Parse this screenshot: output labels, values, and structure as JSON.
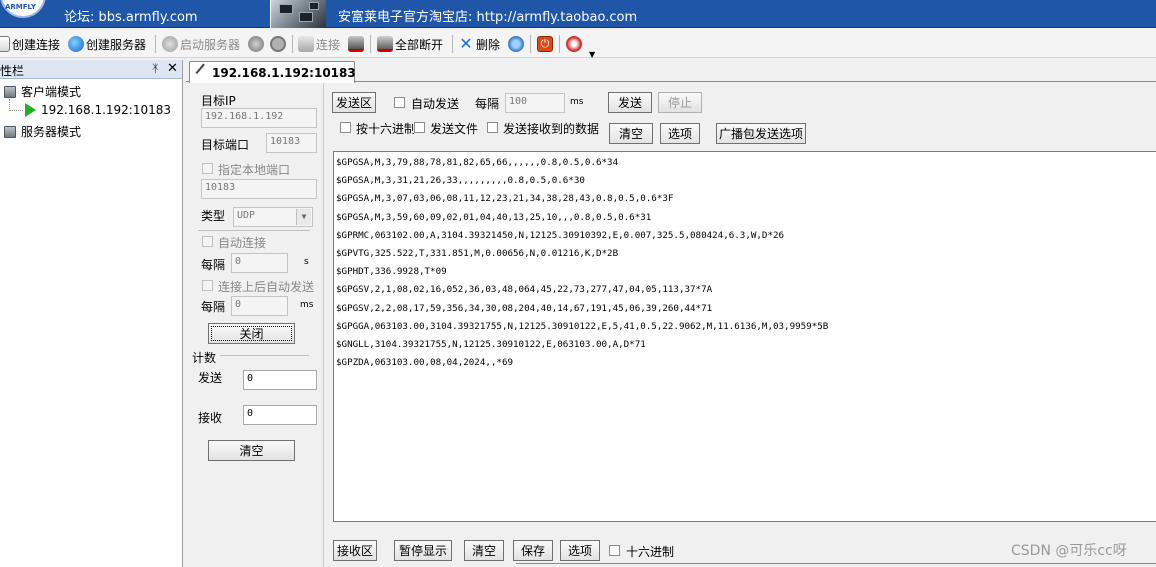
{
  "banner": {
    "logo_text": "ARMFLY",
    "forum_text": "论坛: bbs.armfly.com",
    "shop_text": "安富莱电子官方淘宝店: http://armfly.taobao.com"
  },
  "toolbar": {
    "create_connection": "创建连接",
    "create_server": "创建服务器",
    "start_server": "启动服务器",
    "connect": "连接",
    "disconnect_all": "全部断开",
    "delete": "删除"
  },
  "left_panel": {
    "title": "性栏",
    "client_mode": "客户端模式",
    "client_item": "192.168.1.192:10183",
    "server_mode": "服务器模式"
  },
  "tab": {
    "label": "192.168.1.192:10183"
  },
  "config": {
    "target_ip_label": "目标IP",
    "target_ip_value": "192.168.1.192",
    "target_port_label": "目标端口",
    "target_port_value": "10183",
    "specify_local_port_label": "指定本地端口",
    "local_port_value": "10183",
    "type_label": "类型",
    "type_value": "UDP",
    "auto_connect_label": "自动连接",
    "every_label_1": "每隔",
    "interval_1_value": "0",
    "unit_s": "s",
    "auto_send_after_connect_label": "连接上后自动发送",
    "every_label_2": "每隔",
    "interval_2_value": "0",
    "unit_ms_1": "ms",
    "close_button": "关闭",
    "count_label": "计数",
    "send_label": "发送",
    "send_count": "0",
    "recv_label": "接收",
    "recv_count": "0",
    "clear_button": "清空"
  },
  "send_area": {
    "send_area_label": "发送区",
    "auto_send_label": "自动发送",
    "every_label": "每隔",
    "interval_value": "100",
    "unit_ms": "ms",
    "send_button": "发送",
    "stop_button": "停止",
    "hex_label": "按十六进制",
    "send_file_label": "发送文件",
    "send_received_label": "发送接收到的数据",
    "clear_button": "清空",
    "options_button": "选项",
    "broadcast_button": "广播包发送选项"
  },
  "received_lines": [
    "$GPGSA,M,3,79,88,78,81,82,65,66,,,,,,0.8,0.5,0.6*34",
    "$GPGSA,M,3,31,21,26,33,,,,,,,,,0.8,0.5,0.6*30",
    "$GPGSA,M,3,07,03,06,08,11,12,23,21,34,38,28,43,0.8,0.5,0.6*3F",
    "$GPGSA,M,3,59,60,09,02,01,04,40,13,25,10,,,0.8,0.5,0.6*31",
    "$GPRMC,063102.00,A,3104.39321450,N,12125.30910392,E,0.007,325.5,080424,6.3,W,D*26",
    "$GPVTG,325.522,T,331.851,M,0.00656,N,0.01216,K,D*2B",
    "$GPHDT,336.9928,T*09",
    "$GPGSV,2,1,08,02,16,052,36,03,48,064,45,22,73,277,47,04,05,113,37*7A",
    "$GPGSV,2,2,08,17,59,356,34,30,08,204,40,14,67,191,45,06,39,260,44*71",
    "$GPGGA,063103.00,3104.39321755,N,12125.30910122,E,5,41,0.5,22.9062,M,11.6136,M,03,9959*5B",
    "$GNGLL,3104.39321755,N,12125.30910122,E,063103.00,A,D*71",
    "$GPZDA,063103.00,08,04,2024,,*69"
  ],
  "bottom": {
    "recv_area_label": "接收区",
    "pause_display": "暂停显示",
    "clear": "清空",
    "save": "保存",
    "options": "选项",
    "hex_label": "十六进制"
  },
  "watermark": "CSDN @可乐cc呀"
}
